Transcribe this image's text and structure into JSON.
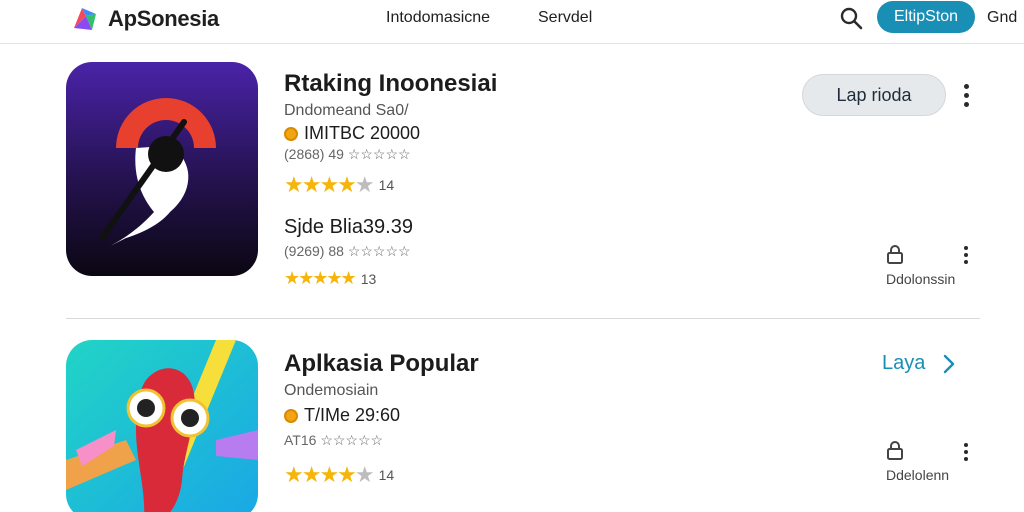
{
  "header": {
    "brand": "ApSonesia",
    "nav": [
      "Intodomasicne",
      "Servdel"
    ],
    "signin_label": "EltipSton",
    "overflow_label": "Gnd"
  },
  "apps": [
    {
      "title": "Rtaking Inoonesiai",
      "subtitle": "Dndomeand  Sa0/",
      "price": "IMITBC 20000",
      "rating_small": "(2868) 49 ☆☆☆☆☆",
      "stars_count": "14",
      "stars_value": 3.5,
      "action_label": "Lap rioda"
    },
    {
      "title": "Sjde Blia39.39",
      "rating_small": "(9269) 88 ☆☆☆☆☆",
      "stars_count": "13",
      "stars_value": 4.5,
      "download_label": "Ddolonssin"
    },
    {
      "title": "Aplkasia Popular",
      "subtitle": "Ondemosiain",
      "price": "T/IMe 29:60",
      "rating_small": "AT16 ☆☆☆☆☆",
      "stars_count": "14",
      "stars_value": 4,
      "more_label": "Laya",
      "download_label": "Ddelolenn"
    }
  ],
  "colors": {
    "accent": "#1a8fb6",
    "star": "#f5b50a",
    "coin": "#f2a512"
  },
  "icons": [
    "brand-logo-icon",
    "search-icon",
    "coin-icon",
    "star-icon",
    "kebab-icon",
    "lock-icon",
    "chevron-right-icon"
  ]
}
